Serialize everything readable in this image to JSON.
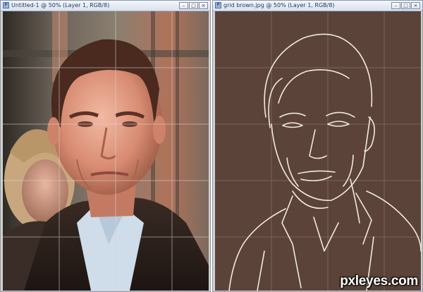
{
  "windows": [
    {
      "title": "Untitled-1 @ 50% (Layer 1, RGB/8)",
      "canvas": {
        "kind": "photo",
        "subject": "portrait-photo"
      }
    },
    {
      "title": "grid brown.jpg @ 50% (Layer 1, RGB/8)",
      "canvas": {
        "kind": "line-sketch",
        "background_color": "#5b4339",
        "line_color": "#f1e8df"
      }
    }
  ],
  "window_buttons": {
    "minimize": "–",
    "maximize": "□",
    "close": "×"
  },
  "watermark": "pxleyes.com",
  "colors": {
    "titlebar": "#dbe3ef",
    "grid_line": "#c8c8c8",
    "canvas_brown": "#5b4339"
  }
}
